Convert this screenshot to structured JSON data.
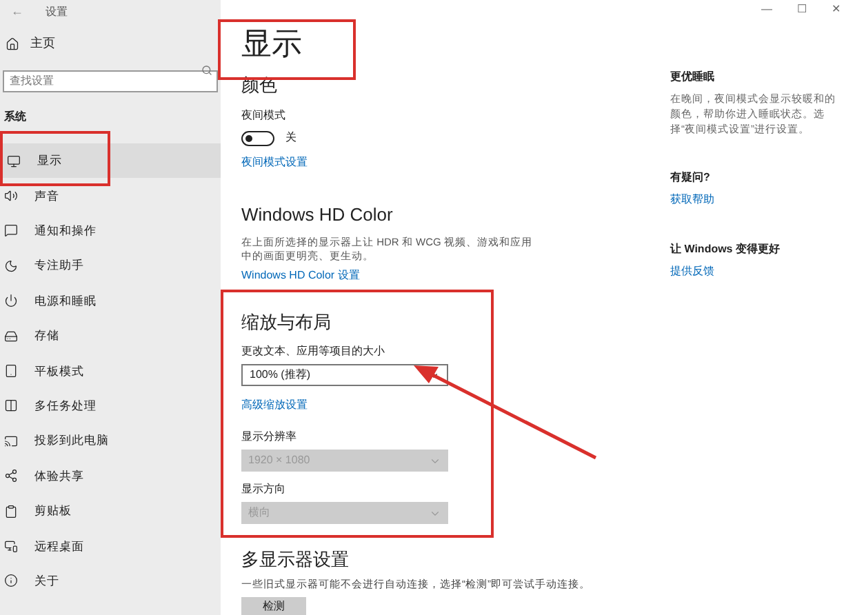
{
  "window": {
    "title": "设置",
    "back": "←",
    "controls": [
      "—",
      "☐",
      "✕"
    ]
  },
  "sidebar": {
    "home": "主页",
    "search": {
      "placeholder": "查找设置"
    },
    "section": "系统",
    "items": [
      {
        "label": "显示",
        "selected": true
      },
      {
        "label": "声音",
        "selected": false
      },
      {
        "label": "通知和操作",
        "selected": false
      },
      {
        "label": "专注助手",
        "selected": false
      },
      {
        "label": "电源和睡眠",
        "selected": false
      },
      {
        "label": "存储",
        "selected": false
      },
      {
        "label": "平板模式",
        "selected": false
      },
      {
        "label": "多任务处理",
        "selected": false
      },
      {
        "label": "投影到此电脑",
        "selected": false
      },
      {
        "label": "体验共享",
        "selected": false
      },
      {
        "label": "剪贴板",
        "selected": false
      },
      {
        "label": "远程桌面",
        "selected": false
      },
      {
        "label": "关于",
        "selected": false
      }
    ]
  },
  "main": {
    "title": "显示",
    "color": {
      "heading": "颜色",
      "night_label": "夜间模式",
      "night_on": false,
      "night_state": "关",
      "link": "夜间模式设置"
    },
    "hd": {
      "heading": "Windows HD Color",
      "description": "在上面所选择的显示器上让 HDR 和 WCG 视频、游戏和应用中的画面更明亮、更生动。",
      "link": "Windows HD Color 设置"
    },
    "scale": {
      "heading": "缩放与布局",
      "fields": [
        {
          "label": "更改文本、应用等项目的大小",
          "value": "100% (推荐)",
          "disabled": false
        },
        {
          "kind": "link",
          "label": "高级缩放设置"
        },
        {
          "label": "显示分辨率",
          "value": "1920 × 1080",
          "disabled": true
        },
        {
          "label": "显示方向",
          "value": "横向",
          "disabled": true
        }
      ]
    },
    "multi": {
      "heading": "多显示器设置",
      "description": "一些旧式显示器可能不会进行自动连接，选择“检测”即可尝试手动连接。",
      "button": "检测"
    }
  },
  "aside": [
    {
      "heading": "更优睡眠",
      "text": "在晚间，夜间模式会显示较暖和的颜色，帮助你进入睡眠状态。选择“夜间模式设置”进行设置。"
    },
    {
      "heading": "有疑问?",
      "link": "获取帮助"
    },
    {
      "heading": "让 Windows 变得更好",
      "link": "提供反馈"
    }
  ]
}
